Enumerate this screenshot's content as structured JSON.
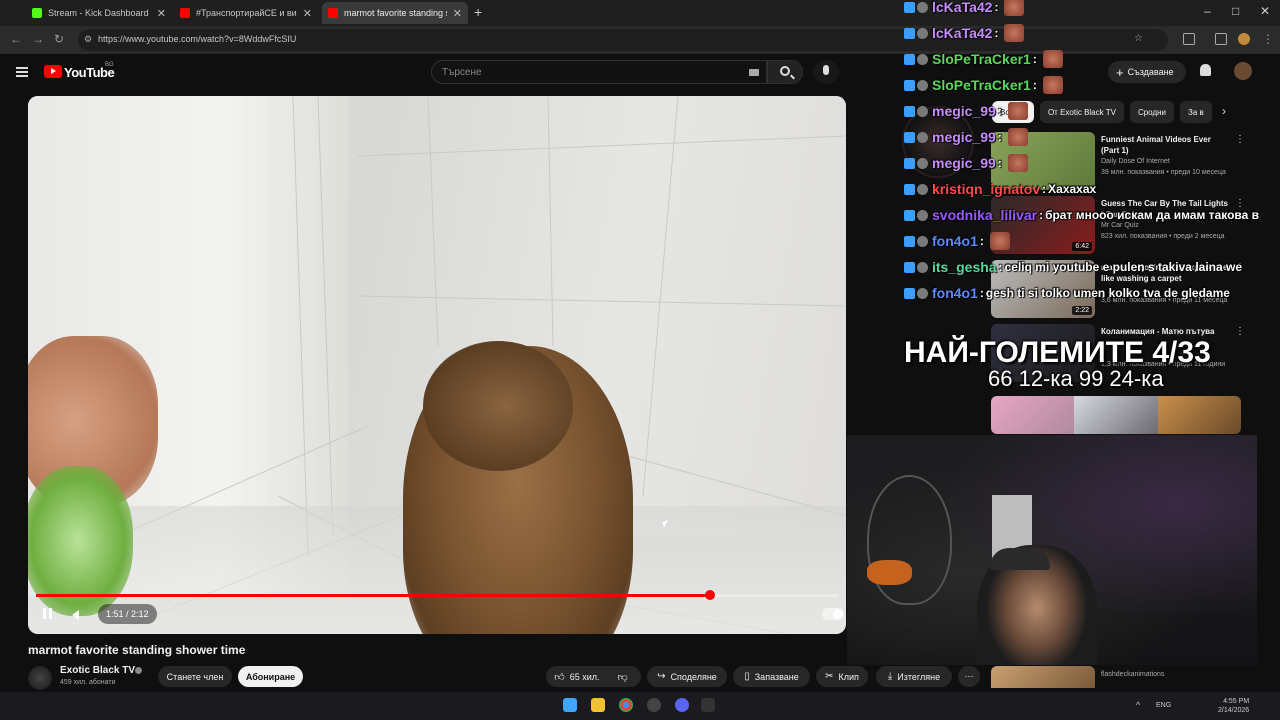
{
  "browser": {
    "tabs": [
      {
        "title": "Stream - Kick Dashboard",
        "color": "#53fc18"
      },
      {
        "title": "#ТранспортирайСЕ и вижкак",
        "color": "#ff0000"
      },
      {
        "title": "marmot favorite standing s",
        "color": "#ff0000"
      }
    ],
    "url": "https://www.youtube.com/watch?v=8WddwFfcSIU"
  },
  "youtube": {
    "logo": "YouTube",
    "region": "BG",
    "search_placeholder": "Търсене",
    "create_label": "Създаване"
  },
  "player": {
    "current_time": "1:51",
    "duration": "2:12",
    "time_display": "1:51 / 2:12",
    "progress_fraction": 0.84
  },
  "video": {
    "title": "marmot favorite standing shower time",
    "channel": "Exotic Black TV",
    "subscribers": "459 хил. абонати",
    "join_label": "Станете член",
    "subscribe_label": "Абониране",
    "likes": "65 хил.",
    "share_label": "Споделяне",
    "save_label": "Запазване",
    "clip_label": "Клип",
    "download_label": "Изтегляне"
  },
  "chips": [
    "Всички",
    "От Exotic Black TV",
    "Сродни",
    "За в"
  ],
  "recommendations": [
    {
      "title": "Funniest Animal Videos Ever (Part 1)",
      "channel": "Daily Dose Of Internet",
      "meta": "39 млн. показвания • преди 10 месеца",
      "duration": "",
      "thumb": "#6a8a4a"
    },
    {
      "title": "Guess The Car By The Tail Lights | Car Quiz",
      "channel": "Mr Car Quiz",
      "meta": "823 хил. показвания • преди 2 месеца",
      "duration": "6:42",
      "thumb": "#7a1c1c"
    },
    {
      "title": "marmot enjoying skill experience like washing a carpet",
      "channel": "",
      "meta": "3,6 млн. показвания • преди 11 месеца",
      "duration": "2:22",
      "thumb": "#9a9a9a"
    },
    {
      "title": "Коланимация - Матю пътува",
      "channel": "",
      "meta": "1,3 млн. показвания • преди 11 години",
      "duration": "",
      "thumb": "#3a3a3a"
    }
  ],
  "chat": [
    {
      "user": "lcKaTa42",
      "msg": "",
      "color": "#c98bff"
    },
    {
      "user": "lcKaTa42",
      "msg": "",
      "color": "#c98bff"
    },
    {
      "user": "SloPeTraCker1",
      "msg": "",
      "color": "#5bd75b"
    },
    {
      "user": "SloPeTraCker1",
      "msg": "",
      "color": "#5bd75b"
    },
    {
      "user": "megic_99",
      "msg": "",
      "color": "#c98bff"
    },
    {
      "user": "megic_99",
      "msg": "",
      "color": "#c98bff"
    },
    {
      "user": "megic_99",
      "msg": "",
      "color": "#c98bff"
    },
    {
      "user": "kristiqn_ignatov",
      "msg": "Хахахах",
      "color": "#ff4b4b"
    },
    {
      "user": "svodnika_lilivar",
      "msg": "брат мнооо искам да имам такова в",
      "color": "#9b59ff"
    },
    {
      "user": "fon4o1",
      "msg": "",
      "color": "#5a8cff"
    },
    {
      "user": "its_gesha",
      "msg": "celiq mi youtube e pulen s takiva laina we",
      "color": "#5bd7a0"
    },
    {
      "user": "fon4o1",
      "msg": "gesh ti si tolko umen kolko tva de gledame",
      "color": "#5a8cff"
    }
  ],
  "overlay": {
    "counter_title": "НАЙ-ГОЛЕМИТЕ 4/33",
    "counter_sub": "66 12-ка 99 24-ка"
  },
  "tray": {
    "lang": "ENG",
    "time": "4:55 PM",
    "date": "2/14/2026"
  }
}
